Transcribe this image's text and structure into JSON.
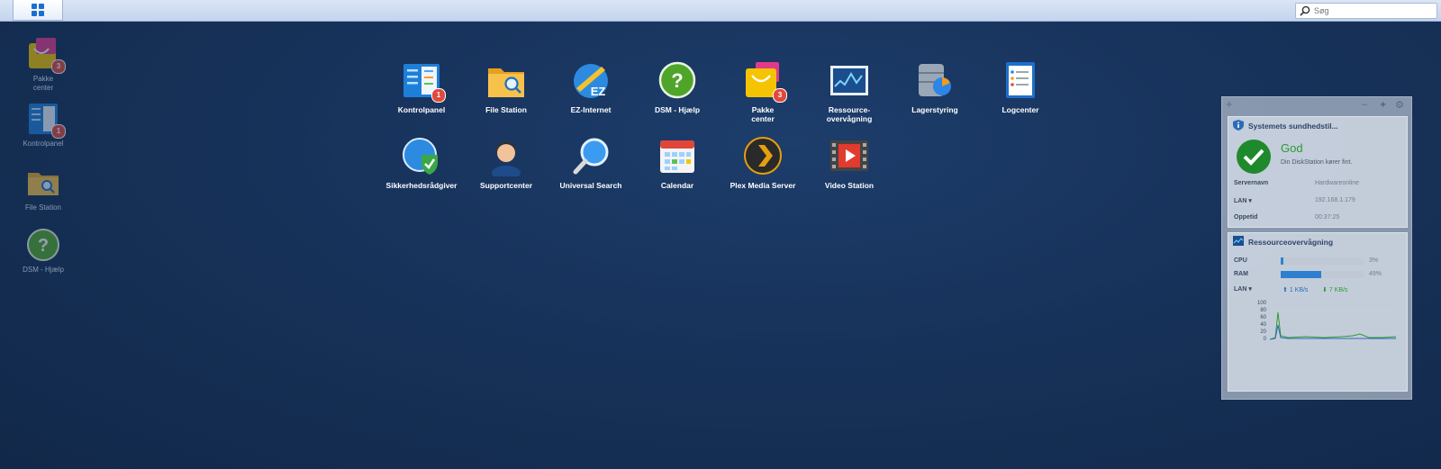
{
  "taskbar": {
    "main_menu_icon": "grid-icon",
    "search": {
      "placeholder": "Søg",
      "icon": "magnifier-icon"
    }
  },
  "desktop_shortcuts": [
    {
      "label": "Pakke\ncenter",
      "icon": "package-center-icon",
      "badge": "3"
    },
    {
      "label": "Kontrolpanel",
      "icon": "control-panel-icon",
      "badge": "1"
    },
    {
      "label": "File Station",
      "icon": "folder-icon"
    },
    {
      "label": "DSM - Hjælp",
      "icon": "help-icon"
    }
  ],
  "launcher": {
    "apps": [
      {
        "label": "Kontrolpanel",
        "icon": "control-panel-icon",
        "badge": "1"
      },
      {
        "label": "File Station",
        "icon": "folder-icon"
      },
      {
        "label": "EZ-Internet",
        "icon": "ez-internet-icon"
      },
      {
        "label": "DSM - Hjælp",
        "icon": "help-icon"
      },
      {
        "label": "Pakke\ncenter",
        "icon": "package-center-icon",
        "badge": "3"
      },
      {
        "label": "Ressource-\novervågning",
        "icon": "resource-monitor-icon"
      },
      {
        "label": "Lagerstyring",
        "icon": "storage-manager-icon"
      },
      {
        "label": "Logcenter",
        "icon": "log-center-icon"
      },
      {
        "label": "Sikkerhedsrådgiver",
        "icon": "security-advisor-icon"
      },
      {
        "label": "Supportcenter",
        "icon": "support-center-icon"
      },
      {
        "label": "Universal Search",
        "icon": "universal-search-icon"
      },
      {
        "label": "Calendar",
        "icon": "calendar-icon"
      },
      {
        "label": "Plex Media Server",
        "icon": "plex-icon"
      },
      {
        "label": "Video Station",
        "icon": "video-station-icon"
      }
    ]
  },
  "widgets": {
    "toolbar": {
      "add": "+",
      "minimize": "–",
      "pin": "✦",
      "settings": "⚙"
    },
    "health": {
      "title": "Systemets sundhedstil...",
      "status": "God",
      "message": "Din DiskStation kører fint.",
      "rows": [
        {
          "key": "Servernavn",
          "value": "Hardwareonline"
        },
        {
          "key": "LAN ▾",
          "value": "192.168.1.179"
        },
        {
          "key": "Oppetid",
          "value": "00:37:25"
        }
      ]
    },
    "resource": {
      "title": "Ressourceovervågning",
      "cpu_label": "CPU",
      "cpu_value": "3%",
      "cpu_pct": 3,
      "ram_label": "RAM",
      "ram_value": "49%",
      "ram_pct": 49,
      "lan_label": "LAN ▾",
      "upload": "1 KB/s",
      "download": "7 KB/s",
      "y_ticks": [
        "100",
        "80",
        "60",
        "40",
        "20",
        "0"
      ]
    }
  },
  "colors": {
    "accent": "#2f7fd0",
    "ok": "#2a8a2a",
    "badge": "#e04a3c"
  }
}
